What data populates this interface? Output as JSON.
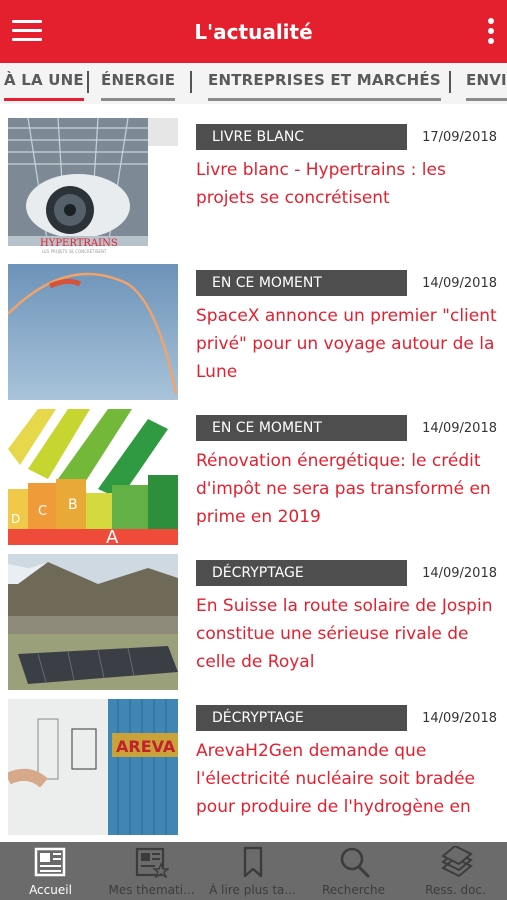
{
  "header": {
    "title": "L'actualité",
    "menu_icon": "hamburger-menu-icon",
    "more_icon": "more-vertical-icon"
  },
  "tabs": [
    {
      "label": "À LA UNE",
      "active": true
    },
    {
      "label": "ÉNERGIE",
      "active": false
    },
    {
      "label": "ENTREPRISES ET MARCHÉS",
      "active": false
    },
    {
      "label": "ENVI",
      "active": false
    }
  ],
  "articles": [
    {
      "category": "LIVRE BLANC",
      "date": "17/09/2018",
      "title": "Livre blanc - Hypertrains : les projets se concrétisent",
      "thumb_caption": "HYPERTRAINS",
      "thumb_subcaption": "LES PROJETS SE CONCRÉTISENT"
    },
    {
      "category": "EN CE MOMENT",
      "date": "14/09/2018",
      "title": "SpaceX annonce un premier \"client privé\" pour un voyage autour de la Lune"
    },
    {
      "category": "EN CE MOMENT",
      "date": "14/09/2018",
      "title": "Rénovation énergétique: le crédit d'impôt ne sera pas transformé en prime en 2019",
      "thumb_letters": [
        "D",
        "C",
        "B",
        "A"
      ]
    },
    {
      "category": "DÉCRYPTAGE",
      "date": "14/09/2018",
      "title": "En Suisse la route solaire de Jospin constitue une sérieuse rivale de celle de Royal"
    },
    {
      "category": "DÉCRYPTAGE",
      "date": "14/09/2018",
      "title": "ArevaH2Gen demande que l'électricité nucléaire soit bradée pour produire de l'hydrogène en",
      "thumb_sign": "AREVA"
    }
  ],
  "bottom_nav": [
    {
      "label": "Accueil",
      "icon": "newspaper-icon",
      "active": true
    },
    {
      "label": "Mes themati...",
      "icon": "newspaper-star-icon",
      "active": false
    },
    {
      "label": "À lire plus ta...",
      "icon": "bookmark-icon",
      "active": false
    },
    {
      "label": "Recherche",
      "icon": "search-icon",
      "active": false
    },
    {
      "label": "Ress. doc.",
      "icon": "documents-stack-icon",
      "active": false
    }
  ],
  "colors": {
    "brand_red": "#e4202f",
    "badge_gray": "#4e4e4e",
    "nav_gray": "#6b6b6b"
  }
}
